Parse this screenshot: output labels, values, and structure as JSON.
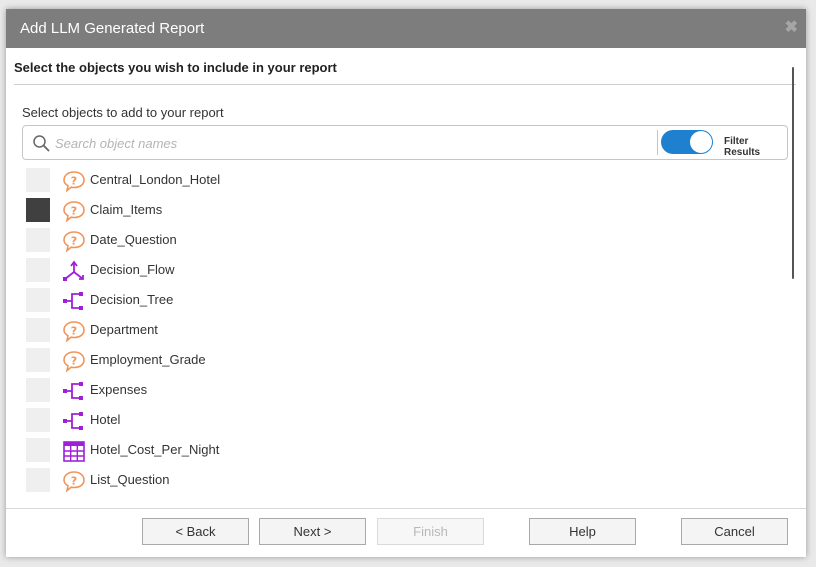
{
  "dialog": {
    "title": "Add LLM Generated Report",
    "close_glyph": "✖"
  },
  "instruction": "Select the objects you wish to include in your report",
  "subheading": "Select objects to add to your report",
  "search": {
    "placeholder": "Search object names",
    "value": "",
    "icon": "search-icon"
  },
  "filter": {
    "label": "Filter Results",
    "enabled": true
  },
  "colors": {
    "question": "#f0955a",
    "flow": "#a020d8",
    "toggle": "#1f80d0",
    "titlebar": "#7d7d7d"
  },
  "objects": [
    {
      "label": "Central_London_Hotel",
      "icon": "question-icon",
      "checked": false
    },
    {
      "label": "Claim_Items",
      "icon": "question-icon",
      "checked": true
    },
    {
      "label": "Date_Question",
      "icon": "question-icon",
      "checked": false
    },
    {
      "label": "Decision_Flow",
      "icon": "flow-icon",
      "checked": false
    },
    {
      "label": "Decision_Tree",
      "icon": "tree-icon",
      "checked": false
    },
    {
      "label": "Department",
      "icon": "question-icon",
      "checked": false
    },
    {
      "label": "Employment_Grade",
      "icon": "question-icon",
      "checked": false
    },
    {
      "label": "Expenses",
      "icon": "tree-icon",
      "checked": false
    },
    {
      "label": "Hotel",
      "icon": "tree-icon",
      "checked": false
    },
    {
      "label": "Hotel_Cost_Per_Night",
      "icon": "table-icon",
      "checked": false
    },
    {
      "label": "List_Question",
      "icon": "question-icon",
      "checked": false
    }
  ],
  "buttons": {
    "back": "< Back",
    "next": "Next >",
    "finish": "Finish",
    "help": "Help",
    "cancel": "Cancel"
  }
}
